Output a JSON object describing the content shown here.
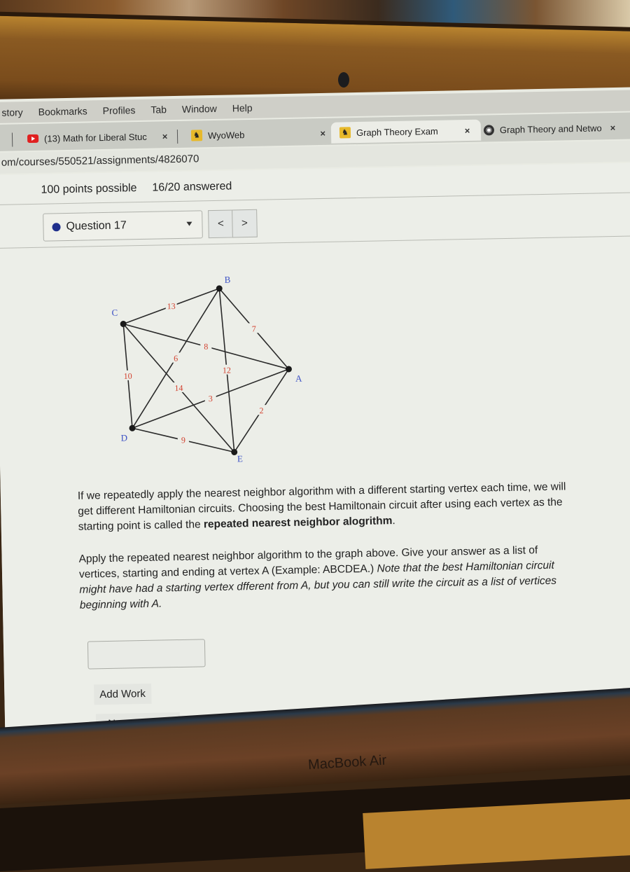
{
  "menubar": {
    "items": [
      "story",
      "Bookmarks",
      "Profiles",
      "Tab",
      "Window",
      "Help"
    ]
  },
  "tabs": [
    {
      "label": "(13) Math for Liberal Stuc",
      "icon": "youtube-icon",
      "close": "×"
    },
    {
      "label": "WyoWeb",
      "icon": "wyoming-cowboy-icon",
      "close": "×"
    },
    {
      "label": "Graph Theory Exam",
      "icon": "wyoming-cowboy-icon",
      "close": "×",
      "active": true
    },
    {
      "label": "Graph Theory and Netwo",
      "icon": "globe-icon",
      "close": "×"
    }
  ],
  "url": "om/courses/550521/assignments/4826070",
  "assignment": {
    "points": "100 points possible",
    "answered": "16/20 answered"
  },
  "question_nav": {
    "selected": "Question 17",
    "prev": "<",
    "next": ">"
  },
  "graph": {
    "vertices": [
      {
        "id": "A"
      },
      {
        "id": "B"
      },
      {
        "id": "C"
      },
      {
        "id": "D"
      },
      {
        "id": "E"
      }
    ],
    "edges": [
      {
        "from": "C",
        "to": "B",
        "weight": "13"
      },
      {
        "from": "B",
        "to": "A",
        "weight": "7"
      },
      {
        "from": "C",
        "to": "A",
        "weight": "8"
      },
      {
        "from": "B",
        "to": "D",
        "weight": "6"
      },
      {
        "from": "B",
        "to": "E",
        "weight": "12"
      },
      {
        "from": "C",
        "to": "D",
        "weight": "10"
      },
      {
        "from": "C",
        "to": "E",
        "weight": "14"
      },
      {
        "from": "D",
        "to": "A",
        "weight": "3"
      },
      {
        "from": "A",
        "to": "E",
        "weight": "2"
      },
      {
        "from": "D",
        "to": "E",
        "weight": "9"
      }
    ],
    "colors": {
      "vertex_label": "#3a4fc4",
      "weight_label": "#d2402e",
      "edge": "#2a2a2a"
    }
  },
  "question": {
    "p1_text": "If we repeatedly apply the nearest neighbor algorithm with a different starting vertex each time, we will get different Hamiltonian circuits. Choosing the best Hamiltonain circuit after using each vertex as the starting point is called the ",
    "p1_bold": "repeated nearest neighbor alogrithm",
    "p1_end": ".",
    "p2_text": "Apply the repeated nearest neighbor algorithm to the graph above. Give your answer as a list of vertices, starting and ending at vertex A (Example: ABCDEA.) ",
    "p2_italic": "Note that the best Hamiltonian circuit might have had a starting vertex dfferent from A, but you can still write the circuit as a list of vertices beginning with A."
  },
  "answer_input": {
    "value": ""
  },
  "buttons": {
    "add_work": "Add Work",
    "next_question": "› Next Question"
  },
  "laptop_brand": "MacBook Air"
}
